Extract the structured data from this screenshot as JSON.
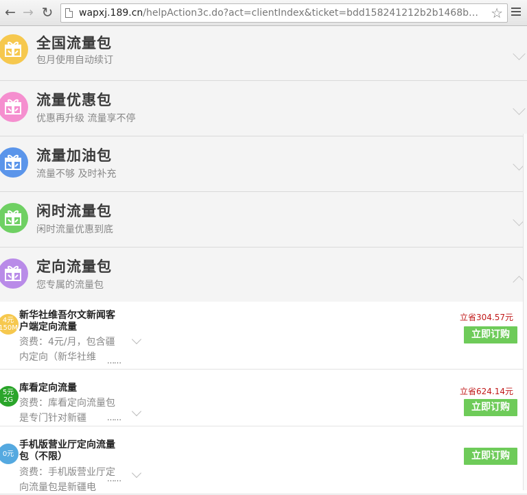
{
  "browser": {
    "url_host": "wapxj.189.cn",
    "url_path": "/helpAction3c.do?act=clientIndex&ticket=bdd158241212b2b1468b2bbc32ca..."
  },
  "categories": [
    {
      "title": "全国流量包",
      "subtitle": "包月使用自动续订",
      "color": "#f6c84e",
      "icon": "gift-icon",
      "expanded": false
    },
    {
      "title": "流量优惠包",
      "subtitle": "优惠再升级 流量享不停",
      "color": "#f58fcf",
      "icon": "gift-icon",
      "expanded": false
    },
    {
      "title": "流量加油包",
      "subtitle": "流量不够 及时补充",
      "color": "#5b95ea",
      "icon": "gift-icon",
      "expanded": false
    },
    {
      "title": "闲时流量包",
      "subtitle": "闲时流量优惠到底",
      "color": "#6fd063",
      "icon": "gift-icon",
      "expanded": false
    },
    {
      "title": "定向流量包",
      "subtitle": "您专属的流量包",
      "color": "#b98be8",
      "icon": "gift-icon",
      "expanded": true
    }
  ],
  "products": [
    {
      "badge_line1": "4元",
      "badge_line2": "150M",
      "badge_color": "#f6c84e",
      "title": "新华社维吾尔文新闻客户端定向流量",
      "desc": "资费：4元/月，包含疆内定向（新华社维",
      "dots": "……",
      "save": "立省304.57元",
      "buy": "立即订购"
    },
    {
      "badge_line1": "5元",
      "badge_line2": "2G",
      "badge_color": "#2aa52a",
      "title": "库看定向流量",
      "desc": "资费：库看定向流量包是专门针对新疆",
      "dots": "……",
      "save": "立省624.14元",
      "buy": "立即订购"
    },
    {
      "badge_line1": "0元",
      "badge_line2": "",
      "badge_color": "#55a9e0",
      "title": "手机版营业厅定向流量包（不限）",
      "desc": "资费：手机版营业厅定向流量包是新疆电",
      "dots": "……",
      "save": "",
      "buy": "立即订购"
    }
  ]
}
